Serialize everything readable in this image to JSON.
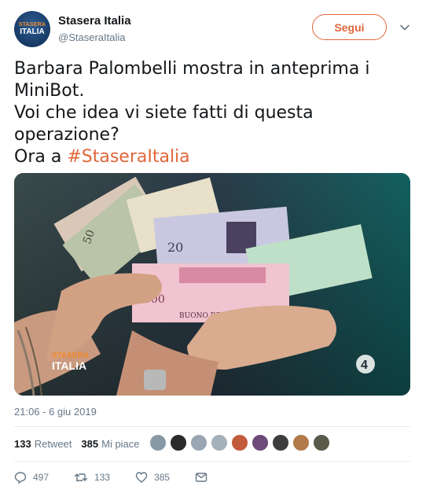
{
  "user": {
    "display_name": "Stasera Italia",
    "handle": "@StaseraItalia",
    "avatar_line1": "STASERA",
    "avatar_line2": "ITALIA"
  },
  "follow_label": "Segui",
  "tweet": {
    "line1": "Barbara Palombelli mostra in anteprima i",
    "line2": "MiniBot.",
    "line3": "Voi che idea vi siete fatti di questa",
    "line4": "operazione?",
    "line5_prefix": "Ora a ",
    "hashtag": "#StaseraItalia"
  },
  "media": {
    "logo_line1": "STASERA",
    "logo_line2": "ITALIA",
    "channel_badge": "4",
    "banknote_values": [
      "20",
      "500",
      "100",
      "50"
    ],
    "banknote_caption": "BUONO DEL TESORO"
  },
  "timestamp": "21:06 - 6 giu 2019",
  "stats": {
    "retweets_count": "133",
    "retweets_label": "Retweet",
    "likes_count": "385",
    "likes_label": "Mi piace"
  },
  "likers": [
    "#8899a6",
    "#2b2b2b",
    "#9aa7b2",
    "#a4b0ba",
    "#c25a3c",
    "#6e4a7a",
    "#3d3d3d",
    "#b07a4a",
    "#5a5a4a"
  ],
  "actions": {
    "replies": "497",
    "retweets": "133",
    "likes": "385"
  },
  "colors": {
    "accent": "#e0663a",
    "secondary_text": "#657786",
    "divider": "#e6ecf0"
  }
}
